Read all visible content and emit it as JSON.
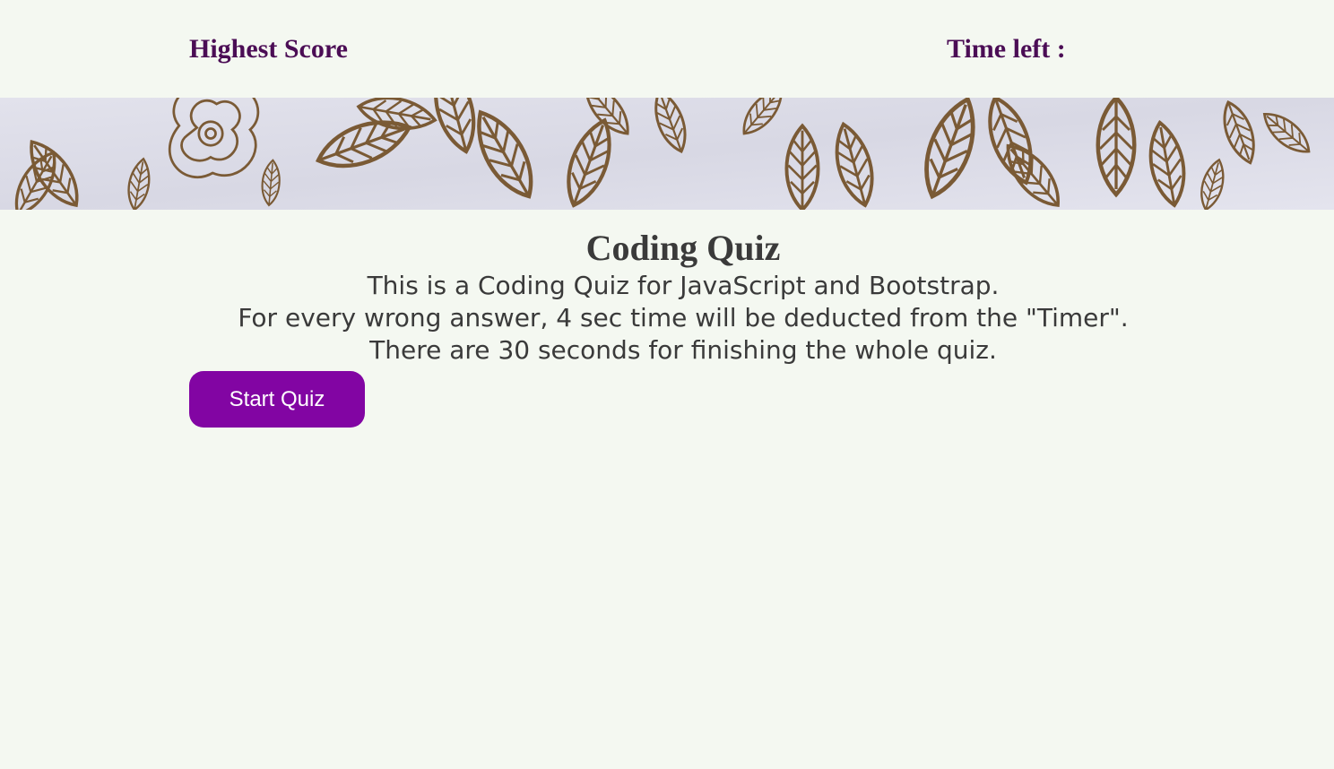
{
  "header": {
    "highscore_label": "Highest Score",
    "timer_label": "Time left :"
  },
  "banner": {
    "description": "",
    "paper_color": "#dcdce6",
    "ink_color": "#7a5a35"
  },
  "main": {
    "title": "Coding Quiz",
    "lines": [
      "This is a Coding Quiz for JavaScript and Bootstrap.",
      "For every wrong answer, 4 sec time will be deducted from the \"Timer\".",
      "There are 30 seconds for finishing the whole quiz."
    ],
    "start_button": "Start Quiz"
  },
  "colors": {
    "background": "#f4f8f1",
    "header_text": "#4b0d55",
    "button": "#8205a3",
    "body_text": "#3a3a3a"
  }
}
